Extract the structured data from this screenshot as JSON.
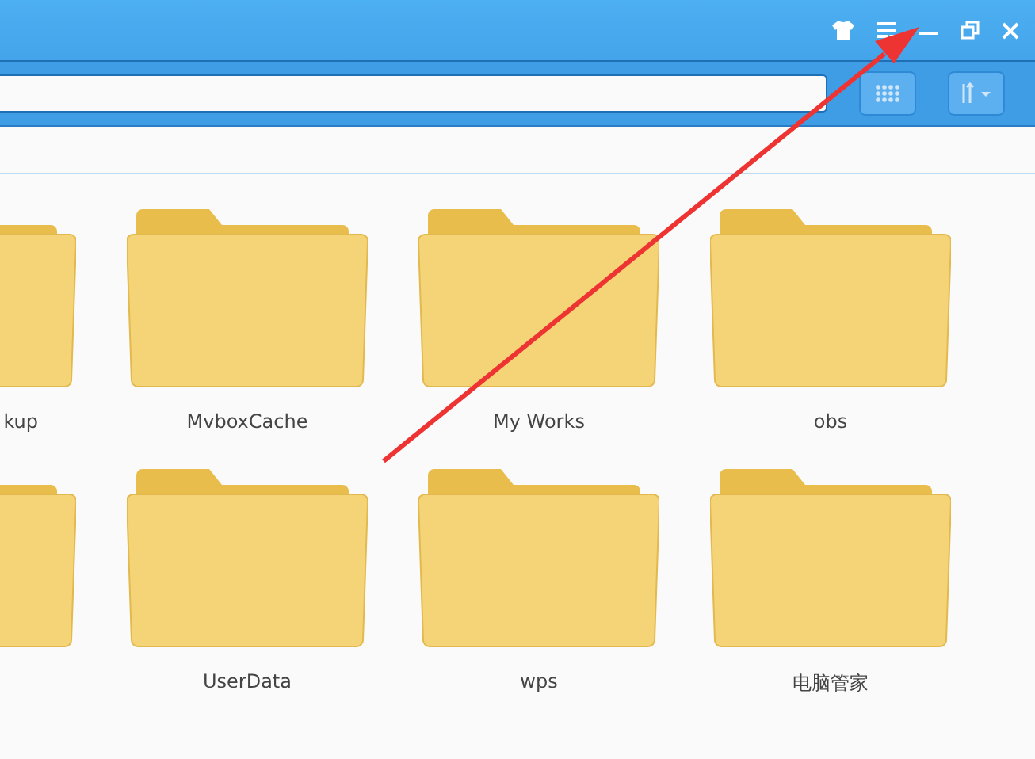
{
  "rows": [
    {
      "edge_folder_name": "kup",
      "folders": [
        {
          "name": "MvboxCache"
        },
        {
          "name": "My Works"
        },
        {
          "name": "obs"
        }
      ]
    },
    {
      "folders": [
        {
          "name": "UserData"
        },
        {
          "name": "wps"
        },
        {
          "name": "电脑管家"
        }
      ]
    }
  ]
}
